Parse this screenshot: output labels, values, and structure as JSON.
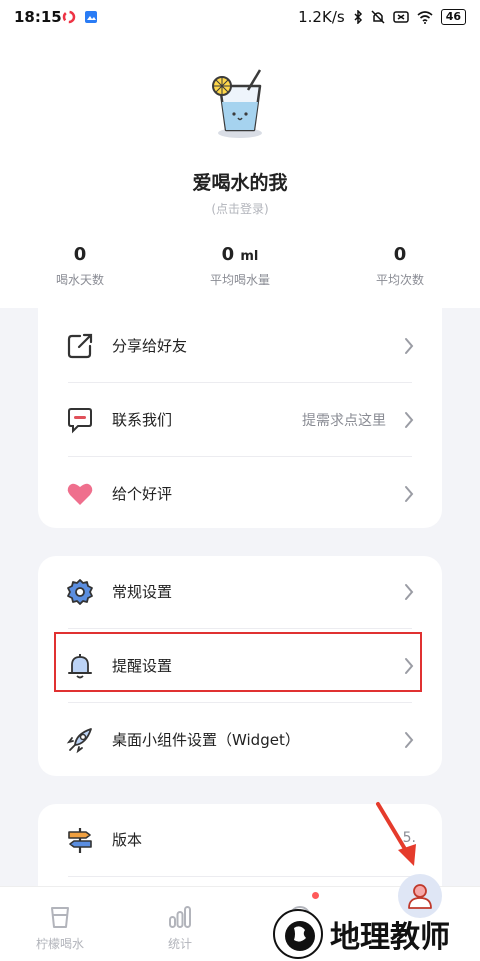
{
  "status_bar": {
    "time": "18:15",
    "net_speed": "1.2K/s",
    "battery": "46"
  },
  "profile": {
    "username": "爱喝水的我",
    "login_hint": "(点击登录)"
  },
  "stats": [
    {
      "value": "0",
      "unit": "",
      "label": "喝水天数"
    },
    {
      "value": "0",
      "unit": "ml",
      "label": "平均喝水量"
    },
    {
      "value": "0",
      "unit": "",
      "label": "平均次数"
    }
  ],
  "card1": [
    {
      "label": "分享给好友",
      "hint": "",
      "icon": "share-icon"
    },
    {
      "label": "联系我们",
      "hint": "提需求点这里",
      "icon": "message-icon"
    },
    {
      "label": "给个好评",
      "hint": "",
      "icon": "heart-icon"
    }
  ],
  "card2": [
    {
      "label": "常规设置",
      "hint": "",
      "icon": "gear-icon"
    },
    {
      "label": "提醒设置",
      "hint": "",
      "icon": "bell-icon"
    },
    {
      "label": "桌面小组件设置（Widget）",
      "hint": "",
      "icon": "rocket-icon"
    }
  ],
  "card3": [
    {
      "label": "版本",
      "hint": "5.",
      "icon": "signpost-icon"
    }
  ],
  "bottom_nav": [
    {
      "label": "柠檬喝水",
      "icon": "cup-icon"
    },
    {
      "label": "统计",
      "icon": "bar-chart-icon"
    },
    {
      "label": "",
      "icon": "face-icon"
    },
    {
      "label": "",
      "icon": "user-icon"
    }
  ],
  "watermark": {
    "text": "地理教师"
  },
  "colors": {
    "accent": "#4a7fd9",
    "highlight": "#e03131",
    "heart": "#ef6f8d",
    "background": "#f3f4f8"
  }
}
